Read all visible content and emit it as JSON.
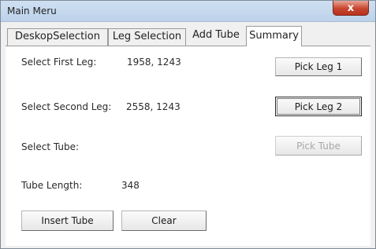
{
  "window": {
    "title": "Main Meru",
    "close_glyph": "x"
  },
  "tabs": [
    {
      "label": "DeskopSelection"
    },
    {
      "label": "Leg Selection"
    },
    {
      "label": "Add Tube"
    },
    {
      "label": "Summary"
    }
  ],
  "form": {
    "first_leg_label": "Select First Leg:",
    "first_leg_value": "1958, 1243",
    "second_leg_label": "Select Second Leg:",
    "second_leg_value": "2558, 1243",
    "tube_label": "Select Tube:",
    "tube_length_label": "Tube Length:",
    "tube_length_value": "348"
  },
  "buttons": {
    "pick_leg_1": "Pick Leg 1",
    "pick_leg_2": "Pick Leg 2",
    "pick_tube": "Pick Tube",
    "insert_tube": "Insert Tube",
    "clear": "Clear"
  }
}
